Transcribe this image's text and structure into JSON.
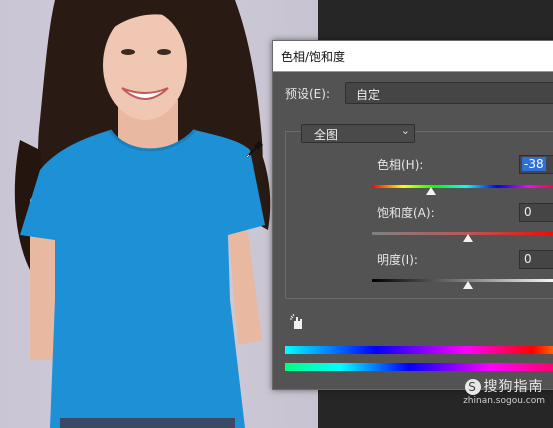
{
  "dialog": {
    "title": "色相/饱和度",
    "preset_label": "预设(E):",
    "preset_value": "自定",
    "channel_value": "全图",
    "hue_label": "色相(H):",
    "hue_value": "-38",
    "saturation_label": "饱和度(A):",
    "saturation_value": "0",
    "lightness_label": "明度(I):",
    "lightness_value": "0"
  },
  "watermark": {
    "main": "搜狗指南",
    "sub": "zhinan.sogou.com"
  },
  "colors": {
    "shirt": "#1e90d6",
    "arrow": "#b01212",
    "dialog_bg": "#535353"
  },
  "icons": [
    "eyedropper-icon",
    "hand-target-icon",
    "chevron-down-icon",
    "sogou-logo-icon"
  ]
}
